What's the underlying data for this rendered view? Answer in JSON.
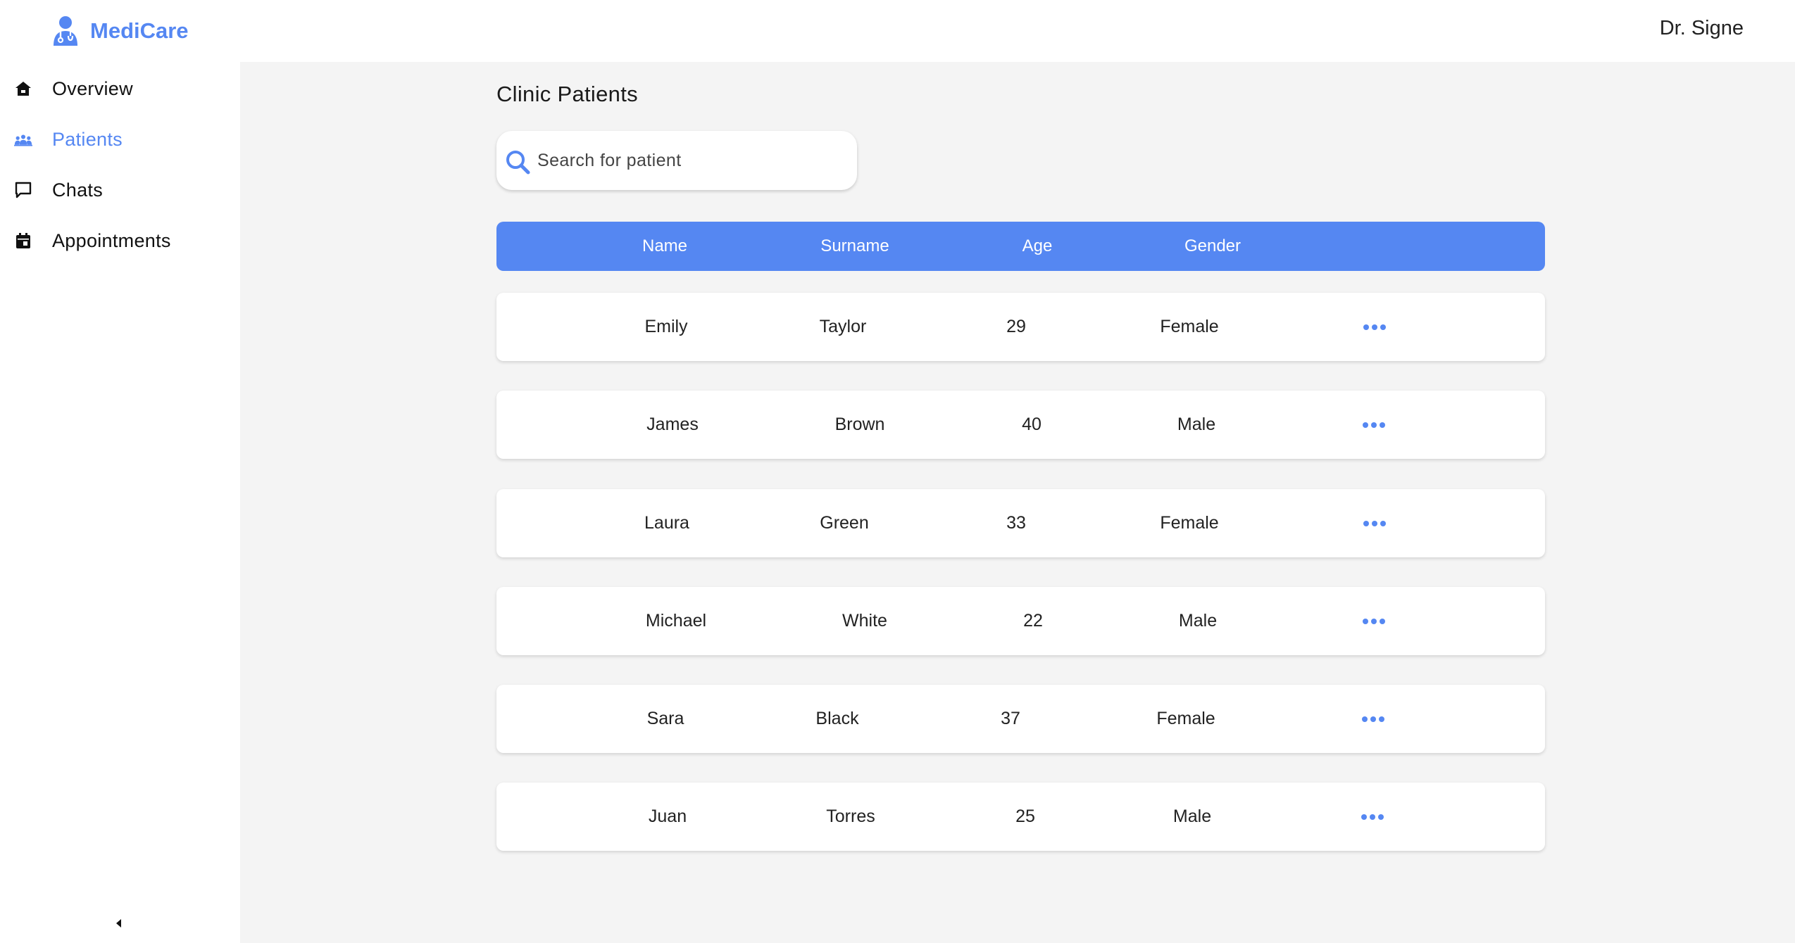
{
  "app": {
    "brand_name": "MediCare",
    "user_name": "Dr. Signe",
    "accent_color": "#5587f2"
  },
  "sidebar": {
    "items": [
      {
        "label": "Overview",
        "icon": "home-icon",
        "active": false
      },
      {
        "label": "Patients",
        "icon": "patients-group-icon",
        "active": true
      },
      {
        "label": "Chats",
        "icon": "chat-bubble-icon",
        "active": false
      },
      {
        "label": "Appointments",
        "icon": "calendar-icon",
        "active": false
      }
    ],
    "collapse_icon": "chevron-left-icon"
  },
  "main": {
    "title": "Clinic Patients",
    "search": {
      "placeholder": "Search for patient",
      "value": ""
    },
    "table": {
      "headers": {
        "name": "Name",
        "surname": "Surname",
        "age": "Age",
        "gender": "Gender"
      },
      "rows": [
        {
          "name": "Emily",
          "surname": "Taylor",
          "age": "29",
          "gender": "Female"
        },
        {
          "name": "James",
          "surname": "Brown",
          "age": "40",
          "gender": "Male"
        },
        {
          "name": "Laura",
          "surname": "Green",
          "age": "33",
          "gender": "Female"
        },
        {
          "name": "Michael",
          "surname": "White",
          "age": "22",
          "gender": "Male"
        },
        {
          "name": "Sara",
          "surname": "Black",
          "age": "37",
          "gender": "Female"
        },
        {
          "name": "Juan",
          "surname": "Torres",
          "age": "25",
          "gender": "Male"
        }
      ],
      "row_action_icon": "more-horizontal-icon"
    }
  }
}
